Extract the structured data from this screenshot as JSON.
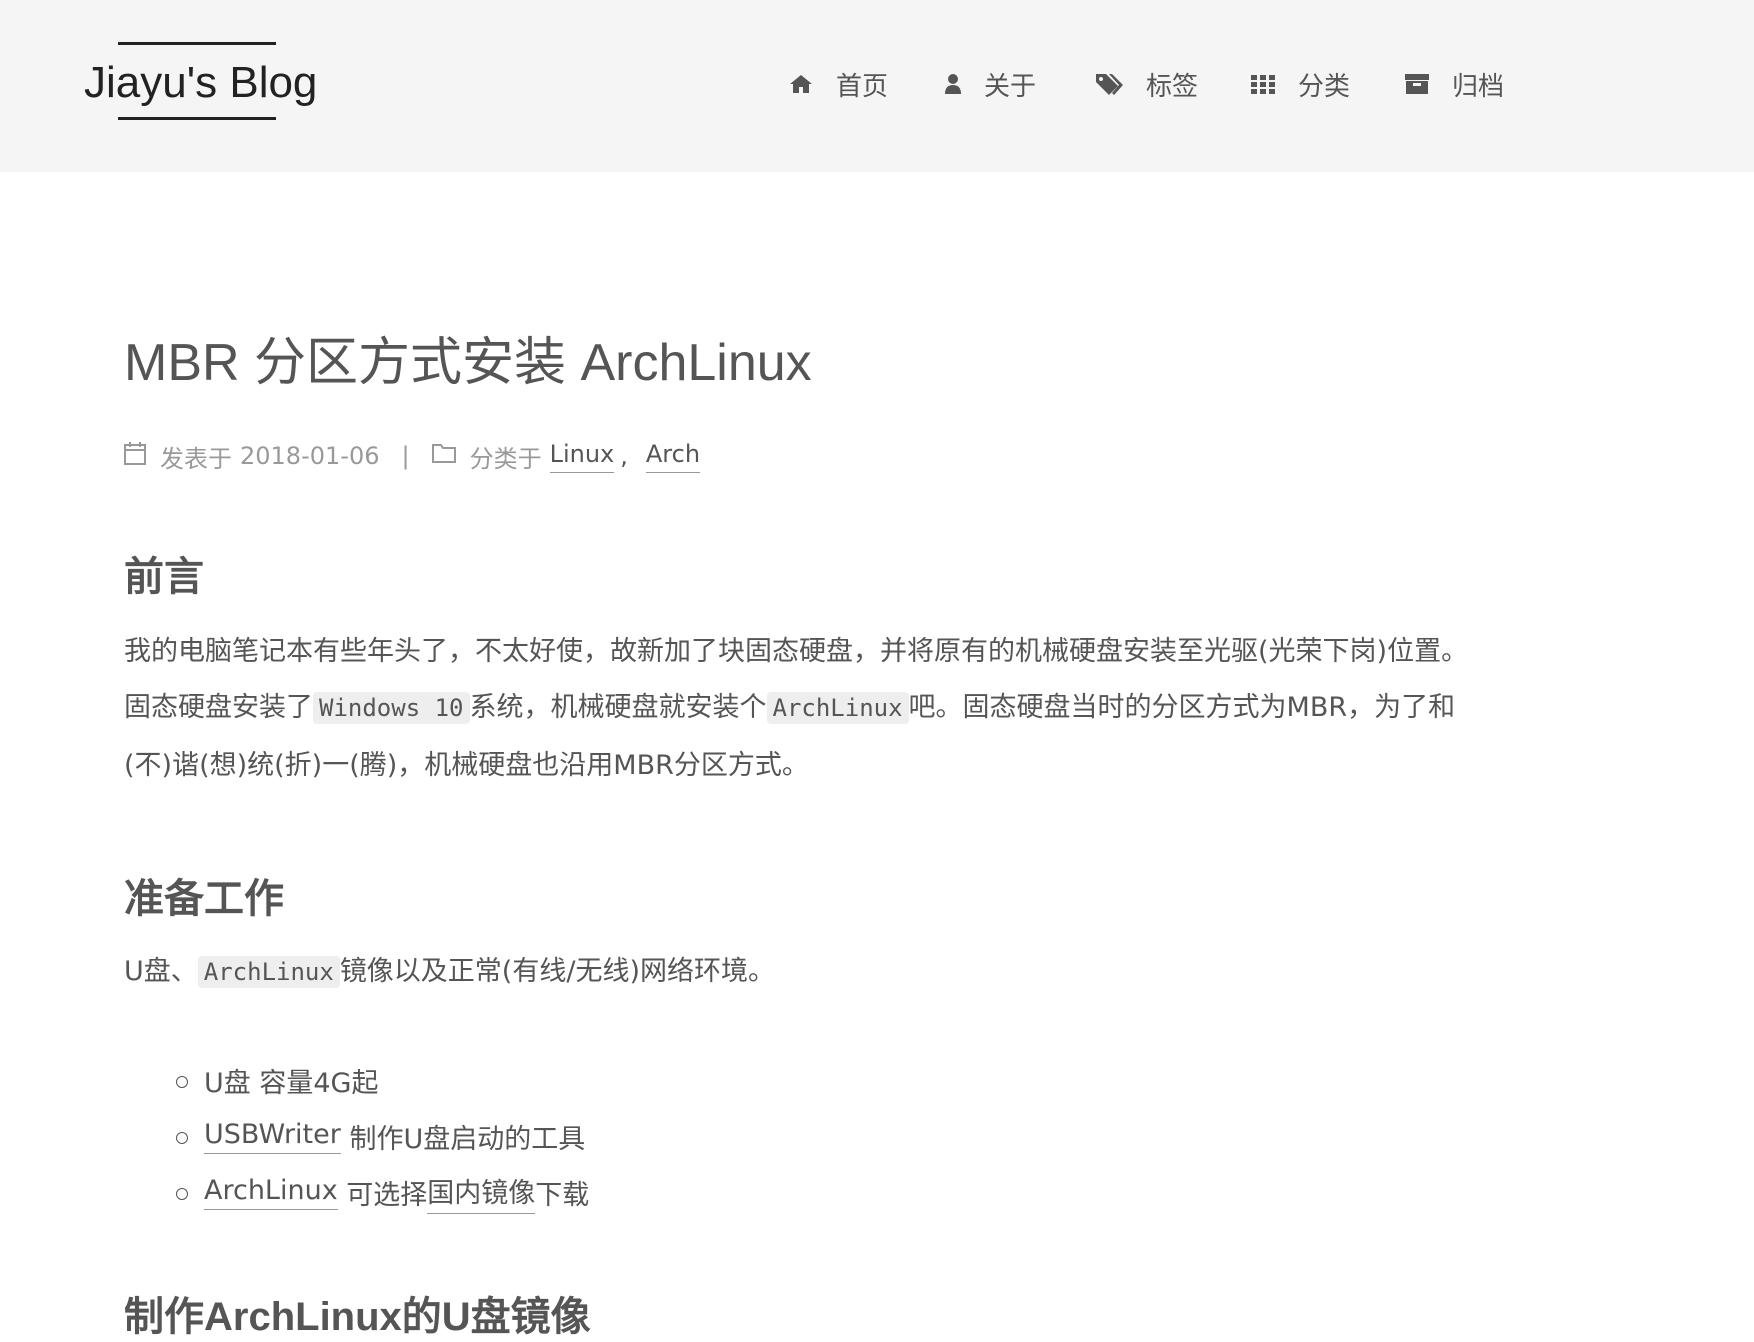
{
  "header": {
    "brand": "Jiayu's Blog",
    "menu": [
      {
        "label": "首页",
        "icon": "home-icon"
      },
      {
        "label": "关于",
        "icon": "user-icon"
      },
      {
        "label": "标签",
        "icon": "tags-icon"
      },
      {
        "label": "分类",
        "icon": "grid-icon"
      },
      {
        "label": "归档",
        "icon": "archive-icon"
      }
    ]
  },
  "post": {
    "title": "MBR 分区方式安装 ArchLinux",
    "meta": {
      "published_label": "发表于",
      "date": "2018-01-06",
      "separator": "|",
      "category_label": "分类于",
      "categories": [
        "Linux",
        "Arch"
      ],
      "comma": ","
    },
    "sections": [
      {
        "heading": "前言",
        "lines": [
          [
            "我的电脑笔记本有些年头了，不太好使，故新加了块固态硬盘，并将原有的机械硬盘安装至光驱(光荣下岗)位置。"
          ],
          [
            "固态硬盘安装了",
            "Windows 10",
            "系统，机械硬盘就安装个",
            "ArchLinux",
            "吧。固态硬盘当时的分区方式为MBR，为了和"
          ],
          [
            "(不)谐(想)统(折)一(腾)，机械硬盘也沿用MBR分区方式。"
          ]
        ]
      },
      {
        "heading": "准备工作",
        "intro": [
          "U盘、",
          "ArchLinux",
          "镜像以及正常(有线/无线)网络环境。"
        ],
        "items": [
          {
            "text": "U盘 容量4G起"
          },
          {
            "link": "USBWriter",
            "text": " 制作U盘启动的工具"
          },
          {
            "link": "ArchLinux",
            "text": " 可选择",
            "link2": "国内镜像",
            "text2": "下载"
          }
        ]
      },
      {
        "heading": "制作ArchLinux的U盘镜像"
      }
    ]
  }
}
